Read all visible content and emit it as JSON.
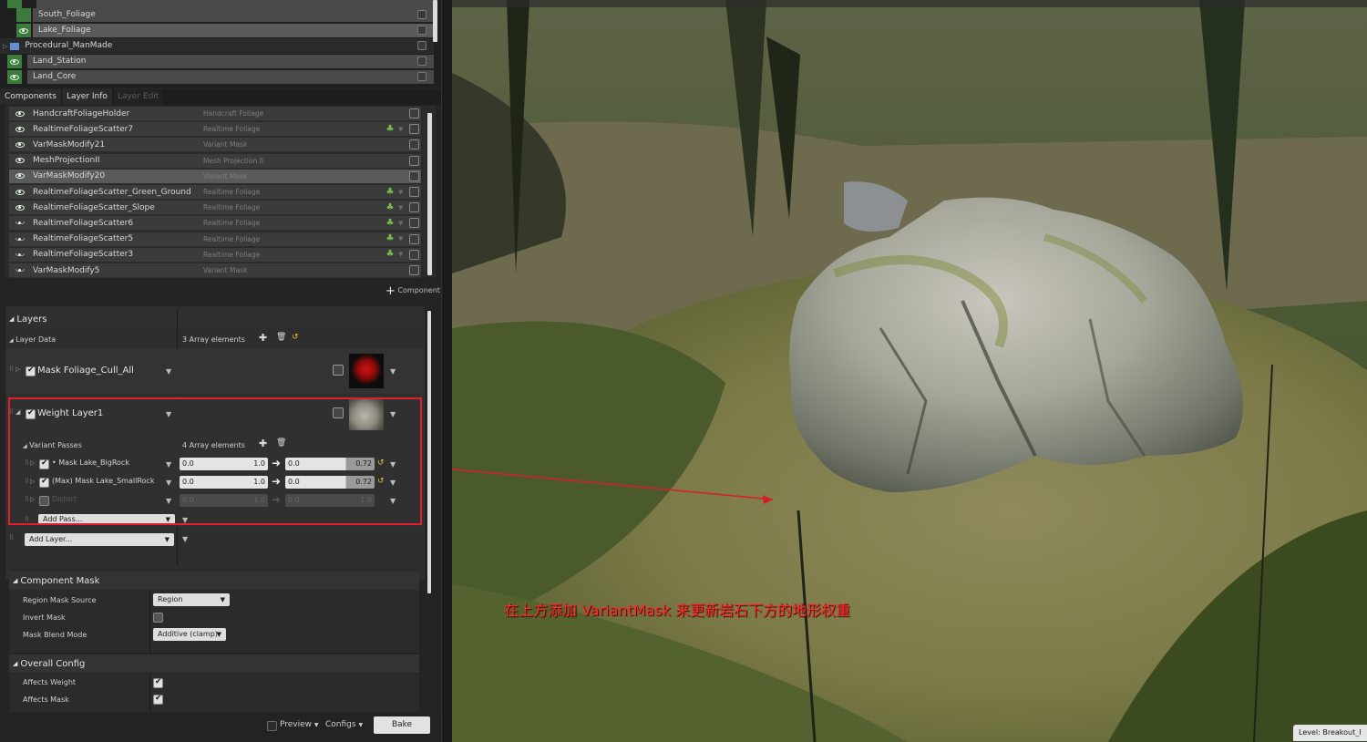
{
  "outliner": {
    "items": [
      {
        "label": "South_Foliage"
      },
      {
        "label": "Lake_Foliage"
      },
      {
        "label": "Procedural_ManMade"
      },
      {
        "label": "Land_Station"
      },
      {
        "label": "Land_Core"
      }
    ]
  },
  "tabs": [
    "Components",
    "Layer Info",
    "Layer Edit"
  ],
  "components": [
    {
      "name": "HandcraftFoliageHolder",
      "type": "Handcraft Foliage"
    },
    {
      "name": "RealtimeFoliageScatter7",
      "type": "Realtime Foliage"
    },
    {
      "name": "VarMaskModify21",
      "type": "Variant Mask"
    },
    {
      "name": "MeshProjectionII",
      "type": "Mesh Projection II"
    },
    {
      "name": "VarMaskModify20",
      "type": "Variant Mask"
    },
    {
      "name": "RealtimeFoliageScatter_Green_Ground",
      "type": "Realtime Foliage"
    },
    {
      "name": "RealtimeFoliageScatter_Slope",
      "type": "Realtime Foliage"
    },
    {
      "name": "RealtimeFoliageScatter6",
      "type": "Realtime Foliage"
    },
    {
      "name": "RealtimeFoliageScatter5",
      "type": "Realtime Foliage"
    },
    {
      "name": "RealtimeFoliageScatter3",
      "type": "Realtime Foliage"
    },
    {
      "name": "VarMaskModify5",
      "type": "Variant Mask"
    }
  ],
  "add_component_label": "Component",
  "layers": {
    "header": "Layers",
    "layer_data_label": "Layer Data",
    "layer_data_count": "3 Array elements",
    "mask_layer_name": "Mask Foliage_Cull_All",
    "weight_layer_name": "Weight Layer1",
    "variant_passes_label": "Variant Passes",
    "variant_passes_count": "4 Array elements",
    "passes": [
      {
        "name": "• Mask Lake_BigRock",
        "a": "0.0",
        "b": "1.0",
        "c": "0.0",
        "d": "0.72"
      },
      {
        "name": "(Max) Mask Lake_SmallRock",
        "a": "0.0",
        "b": "1.0",
        "c": "0.0",
        "d": "0.72"
      },
      {
        "name": "Distort",
        "a": "0.0",
        "b": "1.0",
        "c": "0.0",
        "d": "1.0"
      }
    ],
    "add_pass": "Add Pass...",
    "add_layer": "Add Layer..."
  },
  "component_mask": {
    "header": "Component Mask",
    "region_mask_source_label": "Region Mask Source",
    "region_mask_source_value": "Region",
    "invert_mask_label": "Invert Mask",
    "mask_blend_mode_label": "Mask Blend Mode",
    "mask_blend_mode_value": "Additive (clamp)"
  },
  "overall_config": {
    "header": "Overall Config",
    "affects_weight_label": "Affects Weight",
    "affects_mask_label": "Affects Mask"
  },
  "footer": {
    "preview": "Preview",
    "configs": "Configs",
    "bake": "Bake"
  },
  "viewport": {
    "annotation": "在上方添加 VariantMask 来更新岩石下方的地形权重",
    "level_label": "Level:  Breakout_I"
  },
  "colors": {
    "highlight_box": "#e0202a",
    "annotation_text": "#ff2a2a",
    "eye_green": "#3d7a3d",
    "foliage_icon": "#7ab84a"
  }
}
